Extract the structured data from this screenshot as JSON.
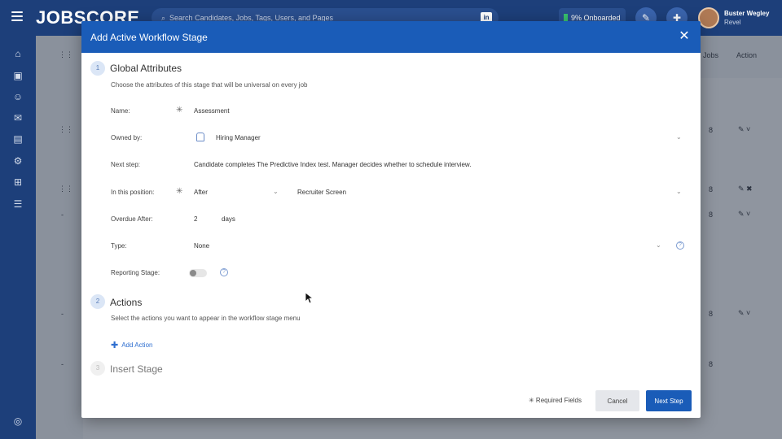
{
  "app": {
    "logo": "JOBSCORE",
    "search_placeholder": "Search Candidates, Jobs, Tags, Users, and Pages",
    "linkedin": "in",
    "onboarded": "9% Onboarded",
    "user_name": "Buster Wegley",
    "user_org": "Revel"
  },
  "background_table": {
    "headers": {
      "jobs": "Jobs",
      "action": "Action"
    },
    "rows": [
      {
        "jobs": "8",
        "dash": "-"
      },
      {
        "jobs": "8",
        "dash": ""
      },
      {
        "jobs": "8",
        "dash": "-"
      },
      {
        "jobs": "8",
        "dash": "-"
      },
      {
        "jobs": "8",
        "dash": "-"
      }
    ]
  },
  "modal": {
    "title": "Add Active Workflow Stage",
    "close": "✕",
    "step1": {
      "number": "1",
      "title": "Global Attributes",
      "description": "Choose the attributes of this stage that will be universal on every job"
    },
    "fields": {
      "name_label": "Name:",
      "name_value": "Assessment",
      "owned_label": "Owned by:",
      "owned_value": "Hiring Manager",
      "next_label": "Next step:",
      "next_value": "Candidate completes The Predictive Index test. Manager decides whether to schedule interview.",
      "position_label": "In this position:",
      "position_relation": "After",
      "position_stage": "Recruiter Screen",
      "overdue_label": "Overdue After:",
      "overdue_value": "2",
      "overdue_unit": "days",
      "type_label": "Type:",
      "type_value": "None",
      "reporting_label": "Reporting Stage:",
      "required_mark": "✳",
      "help_mark": "?"
    },
    "step2": {
      "number": "2",
      "title": "Actions",
      "description": "Select the actions you want to appear in the workflow stage menu",
      "add_action": "Add Action"
    },
    "step3": {
      "number": "3",
      "title": "Insert Stage"
    },
    "footer": {
      "required_fields": "✳  Required Fields",
      "cancel": "Cancel",
      "next": "Next Step"
    }
  }
}
